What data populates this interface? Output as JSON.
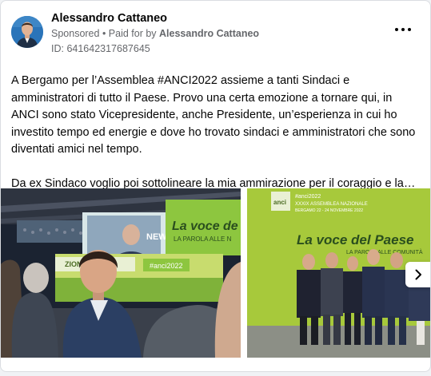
{
  "post": {
    "author": "Alessandro Cattaneo",
    "sponsored_label": "Sponsored",
    "separator": " • ",
    "paid_prefix": "Paid for by ",
    "paid_by": "Alessandro Cattaneo",
    "id_label": "ID: 641642317687645",
    "text_p1": "A Bergamo per l’Assemblea #ANCI2022 assieme a tanti Sindaci e amministratori di tutto il Paese. Provo una certa emozione a tornare qui, in ANCI sono stato Vicepresidente, anche Presidente, un’esperienza in cui ho investito tempo ed energie e dove ho trovato sindaci e amministratori che sono diventati amici nel tempo.",
    "text_p2": "Da ex Sindaco voglio poi sottolineare la mia ammirazione per il coraggio e la…"
  },
  "photo1": {
    "banner_title": "La voce de",
    "banner_sub": "LA PAROLA ALLE N",
    "screen_word": "NEWS",
    "badge_text": "#anci2022",
    "stage_text": "ZIONALE"
  },
  "photo2": {
    "logo_text": "anci",
    "hashtag": "#anci2022",
    "assembly_line1": "XXXIX ASSEMBLEA NAZIONALE",
    "assembly_line2": "BERGAMO 22 - 24 NOVEMBRE 2022",
    "wall_title": "La voce del Paese",
    "wall_sub": "LA PAROLA ALLE COMUNITÀ"
  },
  "icons": {
    "more": "more-horizontal-icon",
    "next": "chevron-right-icon"
  },
  "colors": {
    "text_primary": "#050505",
    "text_secondary": "#65676b",
    "anci_green": "#a3c83a",
    "background": "#f0f2f5"
  }
}
